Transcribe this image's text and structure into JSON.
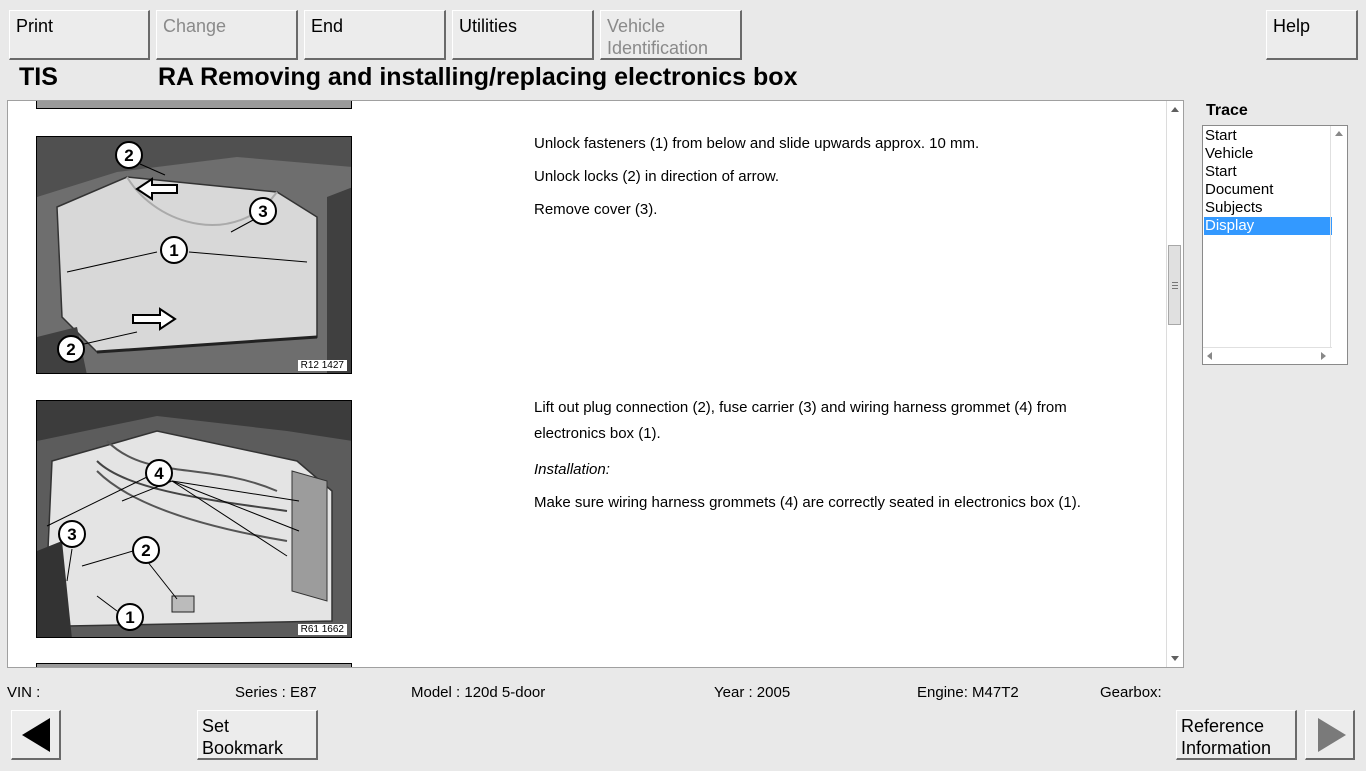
{
  "toolbar": {
    "print": "Print",
    "change": "Change",
    "end": "End",
    "utilities": "Utilities",
    "vehicle_id_line1": "Vehicle",
    "vehicle_id_line2": "Identification",
    "help": "Help"
  },
  "header": {
    "app": "TIS",
    "title": "RA  Removing and installing/replacing electronics box"
  },
  "figures": {
    "fig1_label": "R12 1427",
    "fig2_label": "R61 1662",
    "fig1_callouts": [
      "2",
      "3",
      "1",
      "2"
    ],
    "fig2_callouts": [
      "4",
      "3",
      "2",
      "1"
    ]
  },
  "steps": {
    "step1": [
      "Unlock fasteners (1) from below and slide upwards approx. 10 mm.",
      "Unlock locks (2) in direction of arrow.",
      "Remove cover (3)."
    ],
    "step2": [
      "Lift out plug connection (2), fuse carrier (3) and wiring harness grommet (4) from electronics box (1).",
      "Installation:",
      "Make sure wiring harness grommets (4) are correctly seated in electronics box (1)."
    ]
  },
  "trace": {
    "label": "Trace",
    "items": [
      "Start",
      "Vehicle",
      "Start",
      "Document",
      "Subjects",
      "Display"
    ],
    "selected_index": 5
  },
  "status": {
    "vin": "VIN :",
    "series": "Series : E87",
    "model": "Model : 120d 5-door",
    "year": "Year : 2005",
    "engine": "Engine: M47T2",
    "gearbox": "Gearbox:"
  },
  "bottom": {
    "bookmark_line1": "Set",
    "bookmark_line2": "Bookmark",
    "reference_line1": "Reference",
    "reference_line2": "Information"
  },
  "colors": {
    "selection": "#3399ff",
    "background": "#e9e9e9"
  },
  "icons": {
    "back": "arrow-left-icon",
    "forward": "arrow-right-icon"
  }
}
